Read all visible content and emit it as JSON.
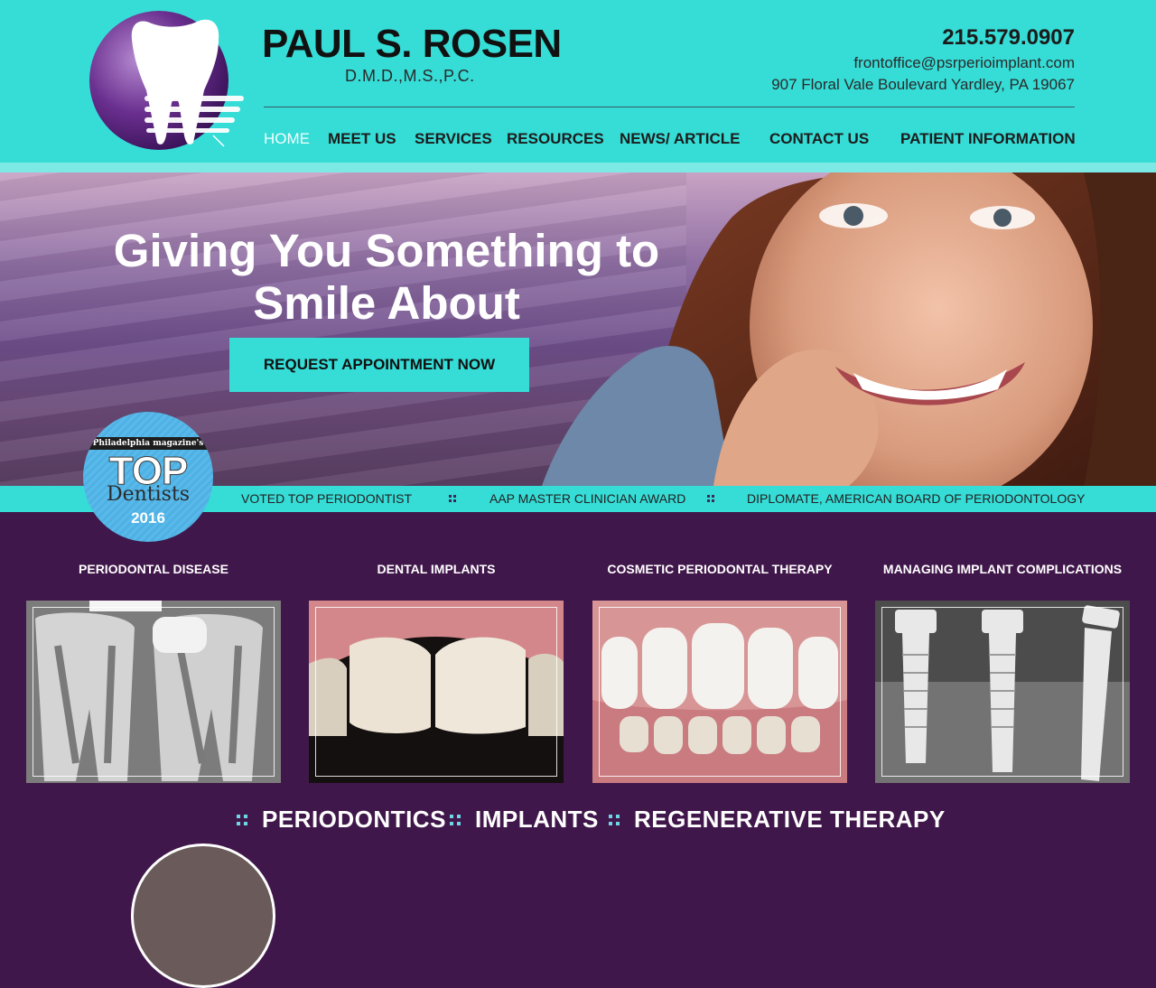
{
  "brand": {
    "name": "PAUL S. ROSEN",
    "credentials": "D.M.D.,M.S.,P.C."
  },
  "contact": {
    "phone": "215.579.0907",
    "email": "frontoffice@psrperioimplant.com",
    "address": "907 Floral Vale Boulevard Yardley, PA 19067"
  },
  "nav": {
    "items": [
      {
        "label": "HOME",
        "active": true
      },
      {
        "label": "MEET US"
      },
      {
        "label": "SERVICES"
      },
      {
        "label": "RESOURCES"
      },
      {
        "label": "NEWS/ ARTICLE"
      },
      {
        "label": "CONTACT US"
      },
      {
        "label": "PATIENT INFORMATION"
      }
    ]
  },
  "hero": {
    "title_line1": "Giving You Something to",
    "title_line2": "Smile About",
    "button_label": "REQUEST APPOINTMENT NOW"
  },
  "badge": {
    "ribbon": "Philadelphia magazine's",
    "top": "TOP",
    "dentists": "Dentists",
    "year": "2016"
  },
  "awards": [
    "VOTED TOP PERIODONTIST",
    "AAP MASTER CLINICIAN AWARD",
    "DIPLOMATE, AMERICAN BOARD OF PERIODONTOLOGY"
  ],
  "services": [
    {
      "title": "PERIODONTAL DISEASE",
      "icon": "xray-teeth-image"
    },
    {
      "title": "DENTAL IMPLANTS",
      "icon": "teeth-closeup-image"
    },
    {
      "title": "COSMETIC PERIODONTAL THERAPY",
      "icon": "smile-teeth-image"
    },
    {
      "title": "MANAGING IMPLANT COMPLICATIONS",
      "icon": "implant-xray-image"
    }
  ],
  "tagline": [
    "PERIODONTICS",
    "IMPLANTS",
    "REGENERATIVE THERAPY"
  ],
  "colors": {
    "teal": "#36dcd6",
    "purple": "#40174a"
  }
}
